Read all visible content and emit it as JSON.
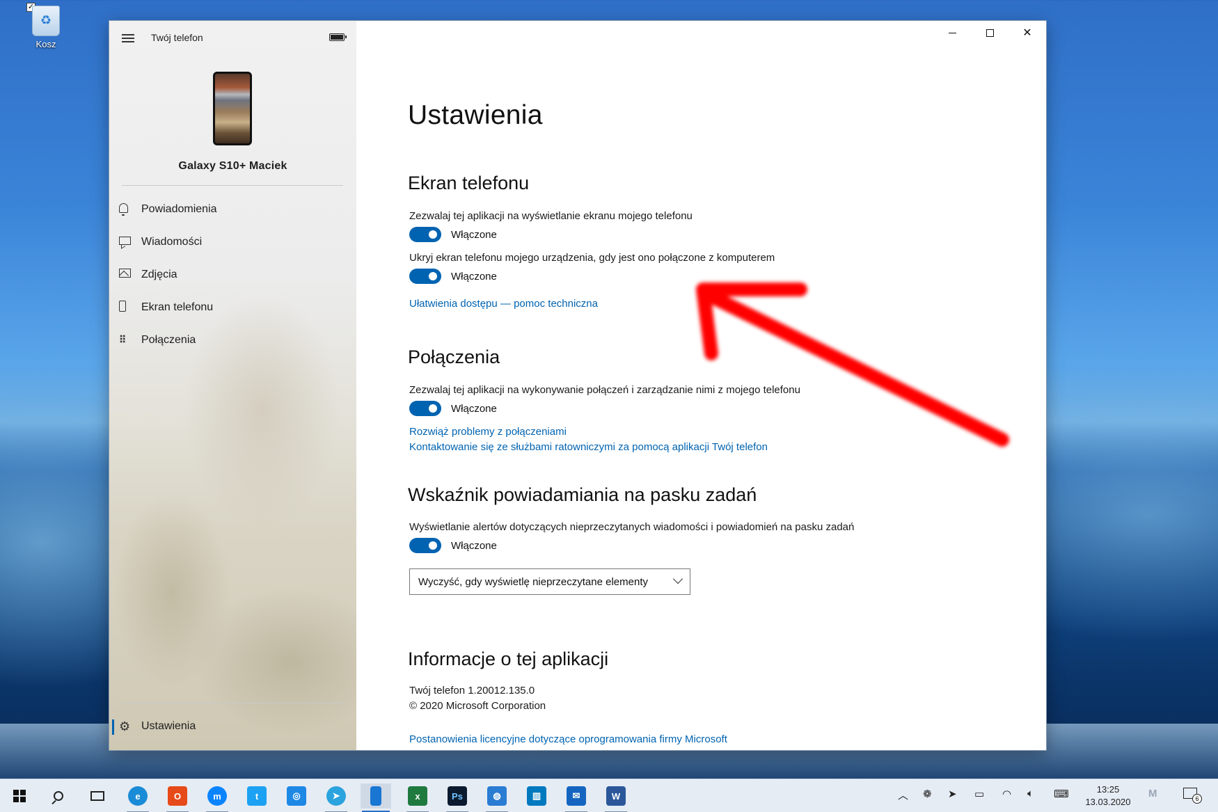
{
  "desktop": {
    "recycle_bin_label": "Kosz"
  },
  "app": {
    "title": "Twój telefon",
    "device_name": "Galaxy S10+ Maciek",
    "nav": [
      {
        "label": "Powiadomienia",
        "icon": "bell-icon"
      },
      {
        "label": "Wiadomości",
        "icon": "message-icon"
      },
      {
        "label": "Zdjęcia",
        "icon": "photos-icon"
      },
      {
        "label": "Ekran telefonu",
        "icon": "phone-screen-icon"
      },
      {
        "label": "Połączenia",
        "icon": "dialpad-icon"
      }
    ],
    "settings_label": "Ustawienia"
  },
  "content": {
    "page_title": "Ustawienia",
    "screen_section": {
      "heading": "Ekran telefonu",
      "setting1_desc": "Zezwalaj tej aplikacji na wyświetlanie ekranu mojego telefonu",
      "setting1_state": "Włączone",
      "setting2_desc": "Ukryj ekran telefonu mojego urządzenia, gdy jest ono połączone z komputerem",
      "setting2_state": "Włączone",
      "accessibility_link": "Ułatwienia dostępu — pomoc techniczna"
    },
    "calls_section": {
      "heading": "Połączenia",
      "setting_desc": "Zezwalaj tej aplikacji na wykonywanie połączeń i zarządzanie nimi z mojego telefonu",
      "setting_state": "Włączone",
      "link1": "Rozwiąż problemy z połączeniami",
      "link2": "Kontaktowanie się ze służbami ratowniczymi za pomocą aplikacji Twój telefon"
    },
    "badge_section": {
      "heading": "Wskaźnik powiadamiania na pasku zadań",
      "setting_desc": "Wyświetlanie alertów dotyczących nieprzeczytanych wiadomości i powiadomień na pasku zadań",
      "setting_state": "Włączone",
      "dropdown_value": "Wyczyść, gdy wyświetlę nieprzeczytane elementy"
    },
    "about_section": {
      "heading": "Informacje o tej aplikacji",
      "version": "Twój telefon 1.20012.135.0",
      "copyright": "© 2020 Microsoft Corporation",
      "license_link": "Postanowienia licencyjne dotyczące oprogramowania firmy Microsoft"
    }
  },
  "taskbar": {
    "apps": [
      "edge-icon",
      "office-icon",
      "messenger-icon",
      "twitter-icon",
      "instagram-icon",
      "telegram-icon",
      "your-phone-icon",
      "excel-icon",
      "photoshop-icon",
      "browser-icon",
      "trello-icon",
      "mail-icon",
      "word-icon"
    ],
    "time": "13:25",
    "date": "13.03.2020",
    "notification_count": "6"
  },
  "colors": {
    "accent": "#0063b1",
    "annotation_arrow": "#ff0000"
  }
}
